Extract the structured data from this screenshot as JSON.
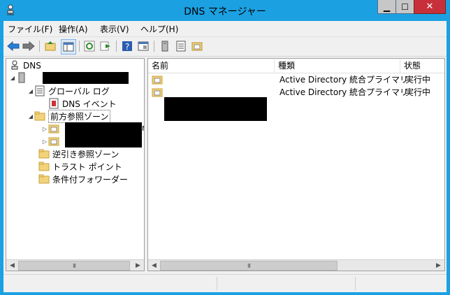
{
  "window": {
    "title": "DNS マネージャー",
    "minimize": "▁",
    "maximize": "☐",
    "close": "✕"
  },
  "menu": [
    {
      "label": "ファイル(F)"
    },
    {
      "label": "操作(A)"
    },
    {
      "label": "表示(V)"
    },
    {
      "label": "ヘルプ(H)"
    }
  ],
  "toolbar": [
    "back-arrow-icon",
    "forward-arrow-icon",
    "up-folder-icon",
    "show-hide-tree-icon",
    "refresh-icon",
    "export-list-icon",
    "help-icon",
    "console-icon",
    "server-icon",
    "list-icon",
    "zone-properties-icon"
  ],
  "tree": {
    "root": "DNS",
    "global_logs": "グローバル ログ",
    "dns_events": "DNS イベント",
    "forward_zones": "前方参照ゾーン",
    "reverse_zones": "逆引き参照ゾーン",
    "trust_points": "トラスト ポイント",
    "conditional_forwarders": "条件付フォワーダー",
    "truncated_char": "r"
  },
  "list": {
    "headers": {
      "name": "名前",
      "type": "種類",
      "status": "状態"
    },
    "rows": [
      {
        "type": "Active Directory 統合プライマリ",
        "status": "実行中"
      },
      {
        "type": "Active Directory 統合プライマリ",
        "status": "実行中"
      }
    ]
  },
  "scroll": {
    "thumb_grip": "III",
    "left": "◀",
    "right": "▶"
  },
  "colors": {
    "titlebar": "#1ba1e2",
    "close_button": "#c7303a",
    "folder": "#f3d37a"
  }
}
